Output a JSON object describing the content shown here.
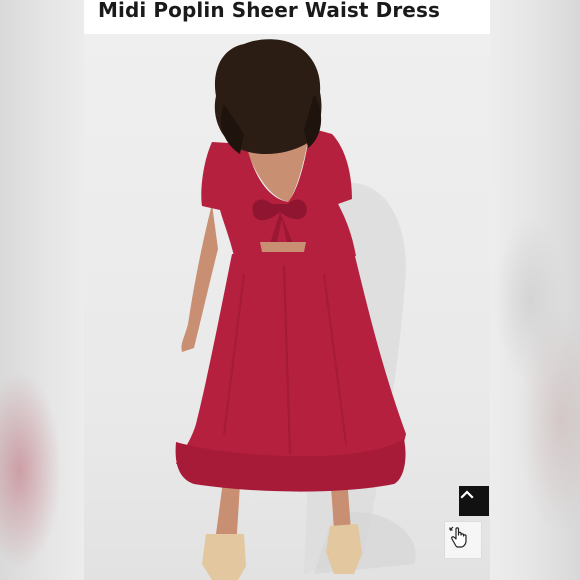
{
  "product": {
    "title": "Midi Poplin Sheer Waist Dress"
  },
  "colors": {
    "dress": "#b5203f",
    "dress_shadow": "#8f1530",
    "background": "#e9e9e9",
    "title": "#1a1a1a"
  },
  "controls": {
    "scroll_top_icon": "chevron-up-icon",
    "touch_icon": "hand-pointer-icon"
  }
}
